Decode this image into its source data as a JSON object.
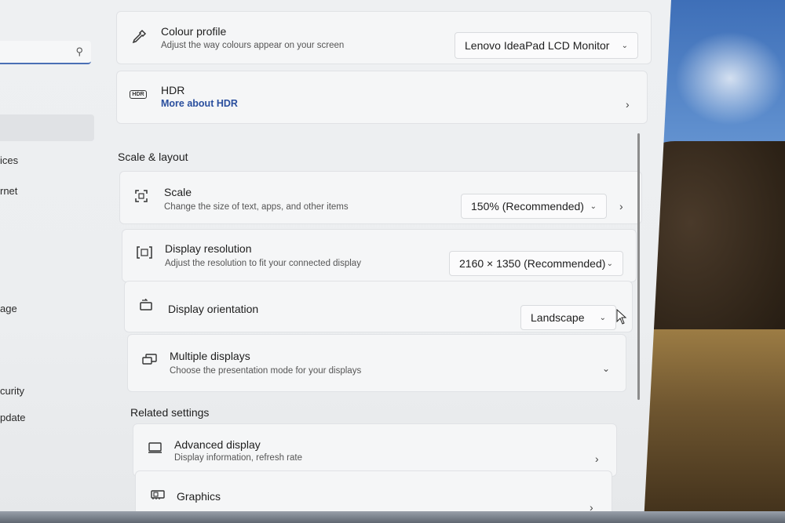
{
  "nav": {
    "items": [
      {
        "label": "ices"
      },
      {
        "label": "rnet"
      },
      {
        "label": "age"
      },
      {
        "label": "curity"
      },
      {
        "label": "pdate"
      }
    ]
  },
  "brightness": {
    "colour_profile": {
      "title": "Colour profile",
      "subtitle": "Adjust the way colours appear on your screen",
      "value": "Lenovo IdeaPad LCD Monitor"
    },
    "hdr": {
      "title": "HDR",
      "link": "More about HDR",
      "icon_text": "HDR"
    }
  },
  "scale_layout": {
    "heading": "Scale & layout",
    "scale": {
      "title": "Scale",
      "subtitle": "Change the size of text, apps, and other items",
      "value": "150% (Recommended)"
    },
    "resolution": {
      "title": "Display resolution",
      "subtitle": "Adjust the resolution to fit your connected display",
      "value": "2160 × 1350 (Recommended)"
    },
    "orientation": {
      "title": "Display orientation",
      "value": "Landscape"
    },
    "multiple": {
      "title": "Multiple displays",
      "subtitle": "Choose the presentation mode for your displays"
    }
  },
  "related": {
    "heading": "Related settings",
    "advanced": {
      "title": "Advanced display",
      "subtitle": "Display information, refresh rate"
    },
    "graphics": {
      "title": "Graphics"
    }
  },
  "colors": {
    "accent": "#2a4f9e",
    "window_bg": "#eceef0",
    "card_bg": "#f5f6f7"
  },
  "icons": {
    "search": "search-icon",
    "colour_profile": "eyedropper-icon",
    "hdr": "hdr-icon",
    "scale": "scale-icon",
    "resolution": "resolution-icon",
    "orientation": "orientation-icon",
    "multiple": "multiple-displays-icon",
    "advanced": "monitor-icon",
    "graphics": "graphics-card-icon"
  }
}
